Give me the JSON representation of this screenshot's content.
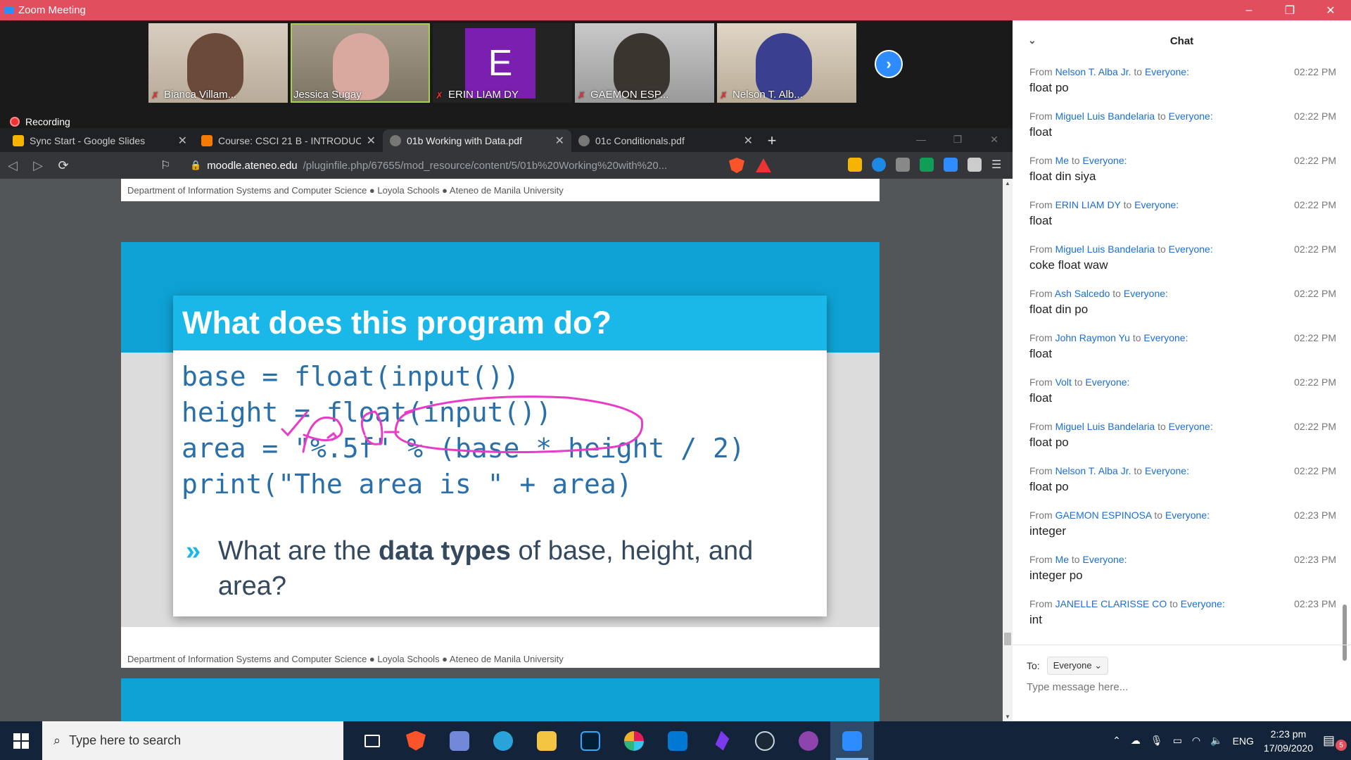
{
  "window": {
    "title": "Zoom Meeting",
    "minimize": "–",
    "restore": "❐",
    "close": "✕"
  },
  "participants": [
    {
      "name": "Bianca Villam...",
      "muted": true
    },
    {
      "name": "Jessica Sugay",
      "muted": false
    },
    {
      "name": "ERIN LIAM DY",
      "muted": true,
      "initial": "E"
    },
    {
      "name": "GAEMON ESP...",
      "muted": true
    },
    {
      "name": "Nelson T. Alb...",
      "muted": true
    }
  ],
  "recording": {
    "label": "Recording"
  },
  "browser": {
    "tabs": [
      {
        "title": "Sync Start - Google Slides",
        "color": "#f4b400"
      },
      {
        "title": "Course: CSCI 21 B - INTRODUCTIO",
        "color": "#f57c00"
      },
      {
        "title": "01b Working with Data.pdf",
        "color": "#777777"
      },
      {
        "title": "01c Conditionals.pdf",
        "color": "#777777"
      }
    ],
    "url_host": "moodle.ateneo.edu",
    "url_path": "/pluginfile.php/67655/mod_resource/content/5/01b%20Working%20with%20..."
  },
  "slide": {
    "footer": "Department of Information Systems and Computer Science ● Loyola Schools  ● Ateneo de Manila University",
    "title": "What does this program do?",
    "code": [
      "base = float(input())",
      "height = float(input())",
      "area = \"%.5f\" % (base * height / 2)",
      "print(\"The area is \" + area)"
    ],
    "bullet_pre": "What are the ",
    "bullet_bold": "data types",
    "bullet_post": " of base, height, and area?"
  },
  "chat": {
    "title": "Chat",
    "messages": [
      {
        "sender": "Nelson T. Alba Jr.",
        "recipient": "Everyone",
        "time": "02:22 PM",
        "text": "float po"
      },
      {
        "sender": "Miguel Luis Bandelaria",
        "recipient": "Everyone",
        "time": "02:22 PM",
        "text": "float"
      },
      {
        "sender": "Me",
        "recipient": "Everyone",
        "time": "02:22 PM",
        "text": "float din siya"
      },
      {
        "sender": "ERIN LIAM DY",
        "recipient": "Everyone",
        "time": "02:22 PM",
        "text": "float"
      },
      {
        "sender": "Miguel Luis Bandelaria",
        "recipient": "Everyone",
        "time": "02:22 PM",
        "text": "coke float waw"
      },
      {
        "sender": "Ash Salcedo",
        "recipient": "Everyone",
        "time": "02:22 PM",
        "text": "float din po"
      },
      {
        "sender": "John Raymon Yu",
        "recipient": "Everyone",
        "time": "02:22 PM",
        "text": "float"
      },
      {
        "sender": "Volt",
        "recipient": "Everyone",
        "time": "02:22 PM",
        "text": "float"
      },
      {
        "sender": "Miguel Luis Bandelaria",
        "recipient": "Everyone",
        "time": "02:22 PM",
        "text": "float po"
      },
      {
        "sender": "Nelson T. Alba Jr.",
        "recipient": "Everyone",
        "time": "02:22 PM",
        "text": "float po"
      },
      {
        "sender": "GAEMON ESPINOSA",
        "recipient": "Everyone",
        "time": "02:23 PM",
        "text": "integer"
      },
      {
        "sender": "Me",
        "recipient": "Everyone",
        "time": "02:23 PM",
        "text": "integer po"
      },
      {
        "sender": "JANELLE CLARISSE CO",
        "recipient": "Everyone",
        "time": "02:23 PM",
        "text": "int"
      }
    ],
    "from_word": "From",
    "to_word": "to",
    "to_label": "To:",
    "recipient_select": "Everyone",
    "input_placeholder": "Type message here..."
  },
  "taskbar": {
    "search_placeholder": "Type here to search",
    "lang": "ENG",
    "time": "2:23 pm",
    "date": "17/09/2020",
    "notifications": "5",
    "apps": [
      "task-view",
      "brave",
      "discord",
      "telegram",
      "file-explorer",
      "photoshop",
      "slack",
      "vscode",
      "obsidian",
      "steam",
      "github",
      "zoom"
    ]
  }
}
